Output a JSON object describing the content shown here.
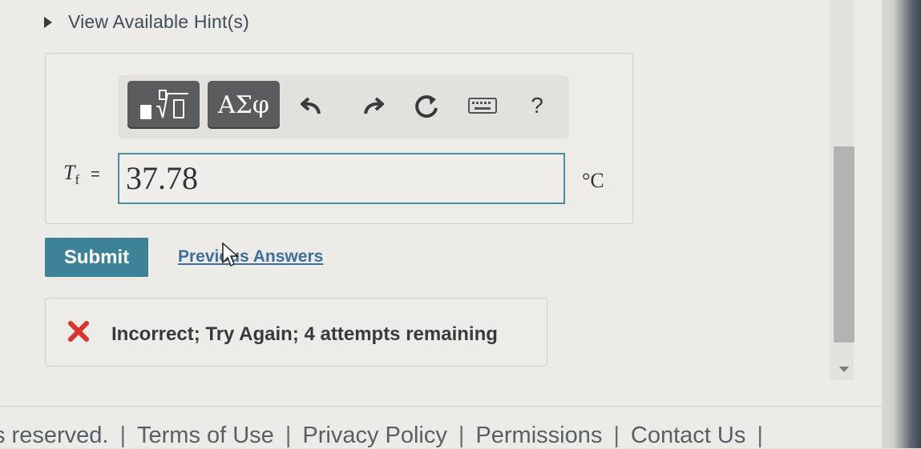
{
  "hint": {
    "label": "View Available Hint(s)"
  },
  "toolbar": {
    "greek_label": "ΑΣφ",
    "help_label": "?",
    "buttons": [
      "templates-icon",
      "undo-icon",
      "redo-icon",
      "reset-icon",
      "keyboard-icon",
      "help-icon"
    ]
  },
  "answer": {
    "variable": "T",
    "subscript": "f",
    "equals": "=",
    "value": "37.78",
    "unit": "°C"
  },
  "actions": {
    "submit_label": "Submit",
    "previous_label": "Previous Answers"
  },
  "feedback": {
    "icon": "x-icon",
    "text": "Incorrect; Try Again; 4 attempts remaining",
    "color": "#d9352c"
  },
  "footer": {
    "rights": "s reserved.",
    "links": [
      "Terms of Use",
      "Privacy Policy",
      "Permissions",
      "Contact Us"
    ]
  },
  "colors": {
    "accent": "#3d8297",
    "link": "#3d6e9c",
    "input_border": "#4a8ea0"
  }
}
